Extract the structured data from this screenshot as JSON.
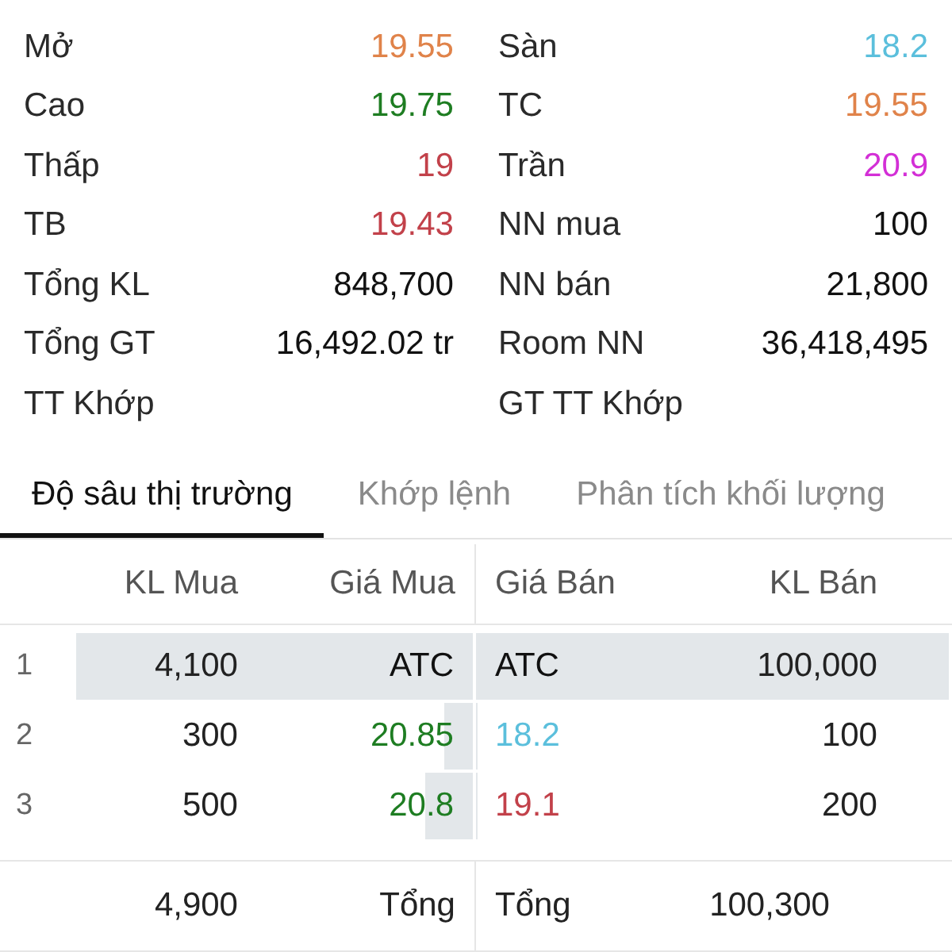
{
  "stats_left": [
    {
      "label": "Mở",
      "value": "19.55",
      "color": "#e0834a"
    },
    {
      "label": "Cao",
      "value": "19.75",
      "color": "#1e7d22"
    },
    {
      "label": "Thấp",
      "value": "19",
      "color": "#c2414a"
    },
    {
      "label": "TB",
      "value": "19.43",
      "color": "#c2414a"
    },
    {
      "label": "Tổng KL",
      "value": "848,700",
      "color": "#111111"
    },
    {
      "label": "Tổng GT",
      "value": "16,492.02 tr",
      "color": "#111111"
    },
    {
      "label": "TT Khớp"
    }
  ],
  "stats_right": [
    {
      "label": "Sàn",
      "value": "18.2",
      "color": "#5bbfdc"
    },
    {
      "label": "TC",
      "value": "19.55",
      "color": "#e0834a"
    },
    {
      "label": "Trần",
      "value": "20.9",
      "color": "#d32fd6"
    },
    {
      "label": "NN mua",
      "value": "100",
      "color": "#111111"
    },
    {
      "label": "NN bán",
      "value": "21,800",
      "color": "#111111"
    },
    {
      "label": "Room NN",
      "value": "36,418,495",
      "color": "#111111"
    },
    {
      "label": "GT TT Khớp"
    }
  ],
  "tabs": [
    {
      "label": "Độ sâu thị trường",
      "selected": true
    },
    {
      "label": "Khớp lệnh",
      "selected": false
    },
    {
      "label": "Phân tích khối lượng",
      "selected": false
    }
  ],
  "order_book": {
    "columns": [
      "KL Mua",
      "Giá Mua",
      "Giá Bán",
      "KL Bán"
    ],
    "rows": [
      {
        "index": "1",
        "buy_volume": "4,100",
        "buy_price": {
          "value": "ATC",
          "color": "#111111"
        },
        "buy_bar": {
          "level": 1
        },
        "sell_price": {
          "value": "ATC",
          "color": "#111111"
        },
        "sell_volume": "100,000",
        "sell_bar": {
          "level": 1
        }
      },
      {
        "index": "2",
        "buy_volume": "300",
        "buy_price": {
          "value": "20.85",
          "color": "#1e7d22"
        },
        "buy_bar": {
          "level": 0.073
        },
        "sell_price": {
          "value": "18.2",
          "color": "#5bbfdc"
        },
        "sell_volume": "100",
        "sell_bar": {
          "level": 0.001
        }
      },
      {
        "index": "3",
        "buy_volume": "500",
        "buy_price": {
          "value": "20.8",
          "color": "#1e7d22"
        },
        "buy_bar": {
          "level": 0.122
        },
        "sell_price": {
          "value": "19.1",
          "color": "#c2414a"
        },
        "sell_volume": "200",
        "sell_bar": {
          "level": 0.002
        }
      }
    ],
    "totals": {
      "buy_volume": "4,900",
      "buy_label": "Tổng",
      "sell_label": "Tổng",
      "sell_volume": "100,300"
    }
  }
}
